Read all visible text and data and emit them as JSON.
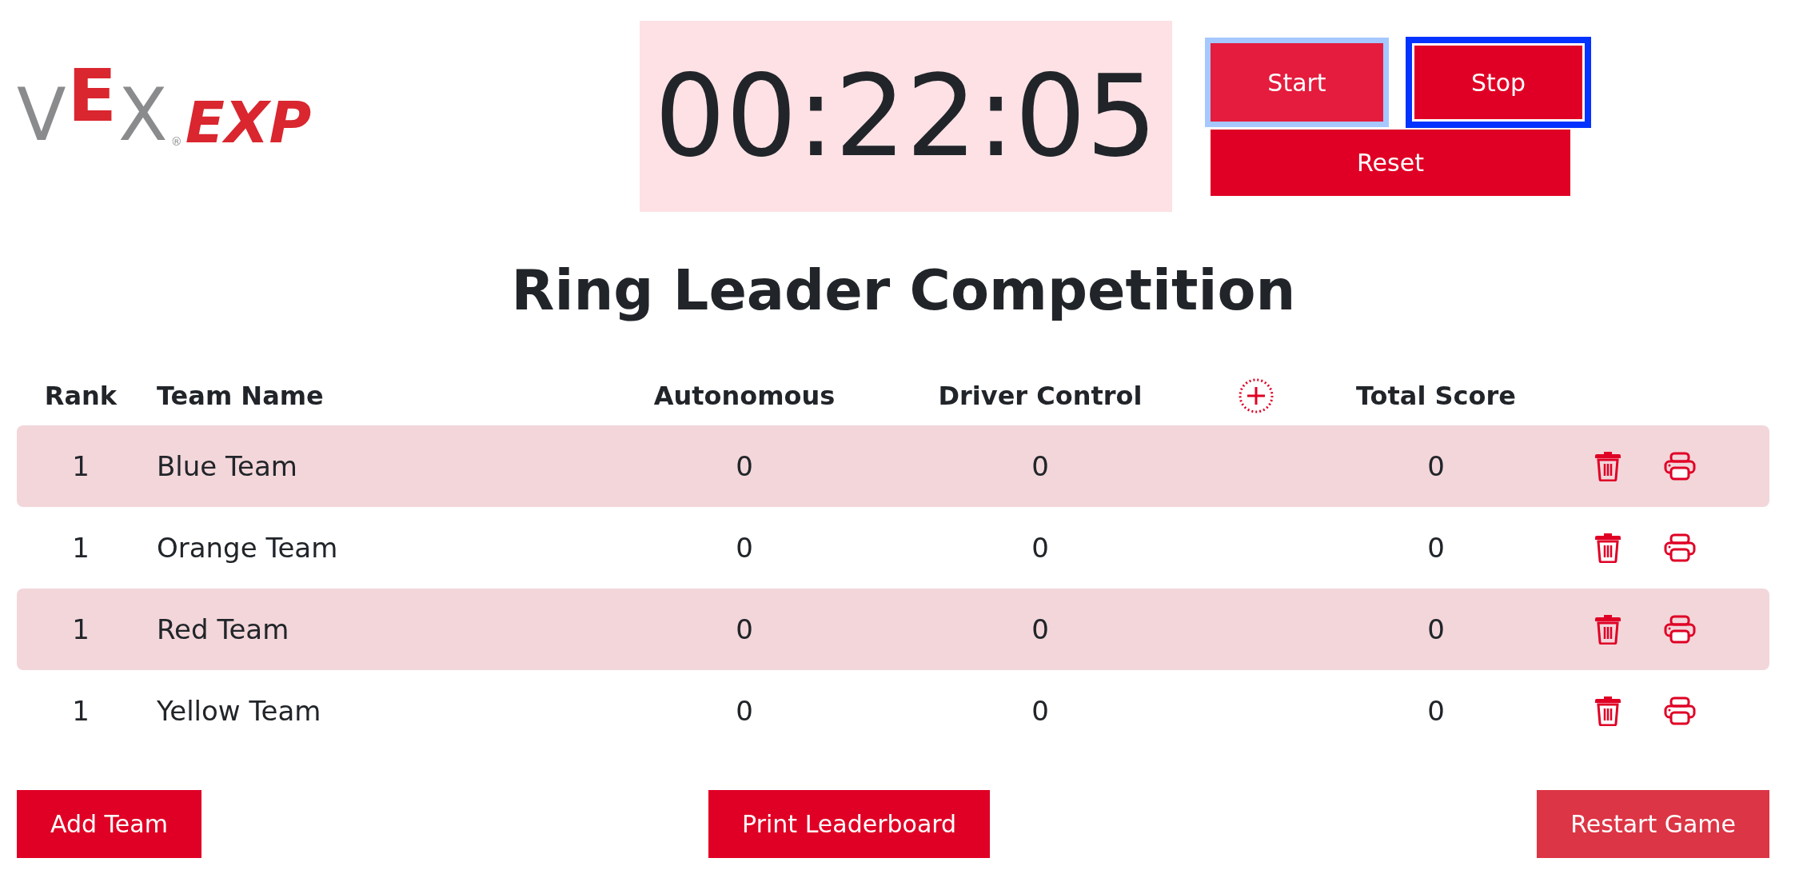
{
  "logo": {
    "brand": "VEX",
    "mark": "®",
    "product": "EXP"
  },
  "timer": {
    "display": "00:22:05"
  },
  "timer_buttons": [
    {
      "label": "Start",
      "hovered": true,
      "focused": false
    },
    {
      "label": "Stop",
      "hovered": false,
      "focused": true
    },
    {
      "label": "Reset",
      "hovered": false,
      "focused": false
    }
  ],
  "title": "Ring Leader Competition",
  "table": {
    "columns": [
      "Rank",
      "Team Name",
      "Autonomous",
      "Driver Control",
      "Total Score"
    ],
    "rows": [
      {
        "rank": "1",
        "team": "Blue Team",
        "autonomous": "0",
        "driver_control": "0",
        "total": "0"
      },
      {
        "rank": "1",
        "team": "Orange Team",
        "autonomous": "0",
        "driver_control": "0",
        "total": "0"
      },
      {
        "rank": "1",
        "team": "Red Team",
        "autonomous": "0",
        "driver_control": "0",
        "total": "0"
      },
      {
        "rank": "1",
        "team": "Yellow Team",
        "autonomous": "0",
        "driver_control": "0",
        "total": "0"
      }
    ]
  },
  "buttons": [
    {
      "label": "Add Team",
      "kind": "primary"
    },
    {
      "label": "Print Leaderboard",
      "kind": "primary"
    },
    {
      "label": "Restart Game",
      "kind": "danger"
    }
  ]
}
